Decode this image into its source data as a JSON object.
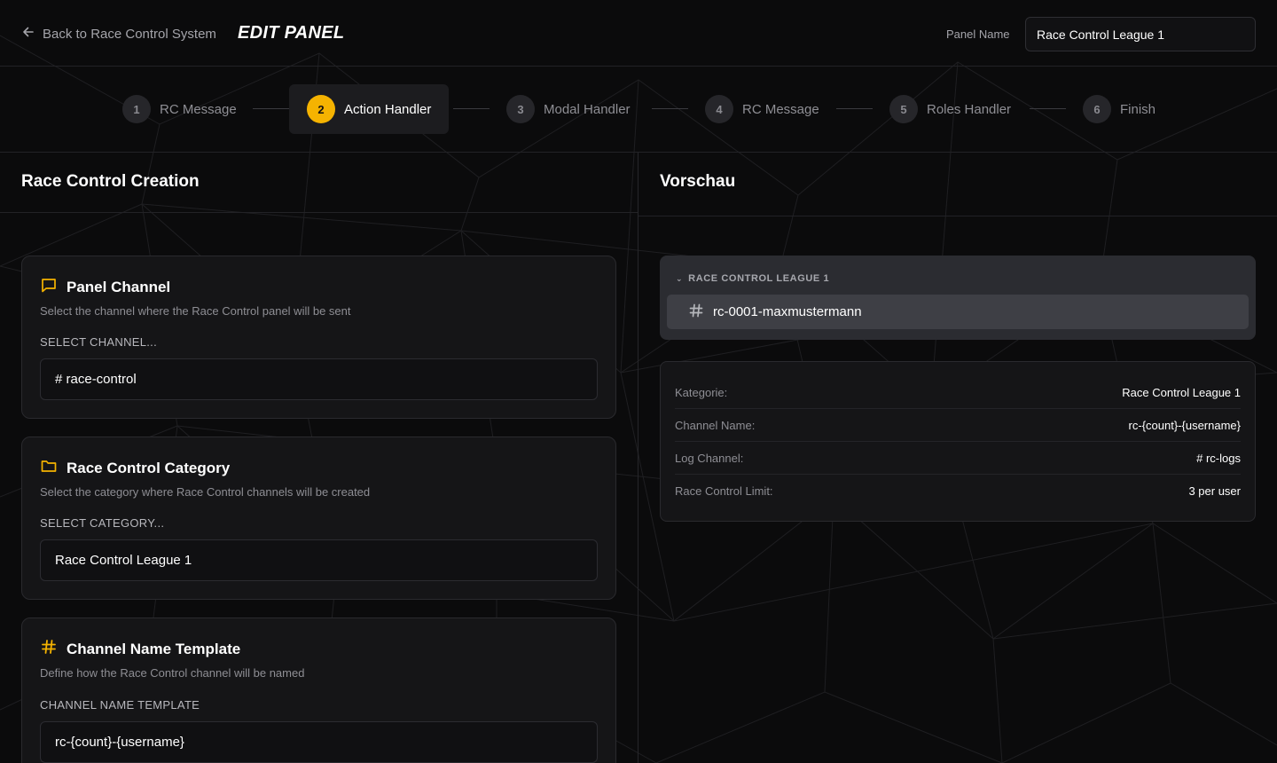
{
  "header": {
    "back_label": "Back to Race Control System",
    "title": "EDIT PANEL",
    "panel_name_label": "Panel Name",
    "panel_name_value": "Race Control League 1"
  },
  "stepper": {
    "steps": [
      {
        "num": "1",
        "label": "RC Message"
      },
      {
        "num": "2",
        "label": "Action Handler"
      },
      {
        "num": "3",
        "label": "Modal Handler"
      },
      {
        "num": "4",
        "label": "RC Message"
      },
      {
        "num": "5",
        "label": "Roles Handler"
      },
      {
        "num": "6",
        "label": "Finish"
      }
    ],
    "active_index": 1
  },
  "left": {
    "heading": "Race Control Creation",
    "cards": [
      {
        "icon": "message-square-icon",
        "title": "Panel Channel",
        "desc": "Select the channel where the Race Control panel will be sent",
        "label": "SELECT CHANNEL...",
        "value": "# race-control"
      },
      {
        "icon": "folder-icon",
        "title": "Race Control Category",
        "desc": "Select the category where Race Control channels will be created",
        "label": "SELECT CATEGORY...",
        "value": "Race Control League 1"
      },
      {
        "icon": "hash-icon",
        "title": "Channel Name Template",
        "desc": "Define how the Race Control channel will be named",
        "label": "CHANNEL NAME TEMPLATE",
        "value": "rc-{count}-{username}"
      }
    ]
  },
  "right": {
    "heading": "Vorschau",
    "preview": {
      "category": "RACE CONTROL LEAGUE 1",
      "channel": "rc-0001-maxmustermann"
    },
    "info": [
      {
        "key": "Kategorie:",
        "value": "Race Control League 1"
      },
      {
        "key": "Channel Name:",
        "value": "rc-{count}-{username}"
      },
      {
        "key": "Log Channel:",
        "value": "# rc-logs"
      },
      {
        "key": "Race Control Limit:",
        "value": "3 per user"
      }
    ]
  },
  "colors": {
    "accent": "#f5b301",
    "background": "#0b0b0c",
    "card": "#151517",
    "preview_bg": "#2b2c31",
    "preview_selected": "#3e3f45"
  }
}
